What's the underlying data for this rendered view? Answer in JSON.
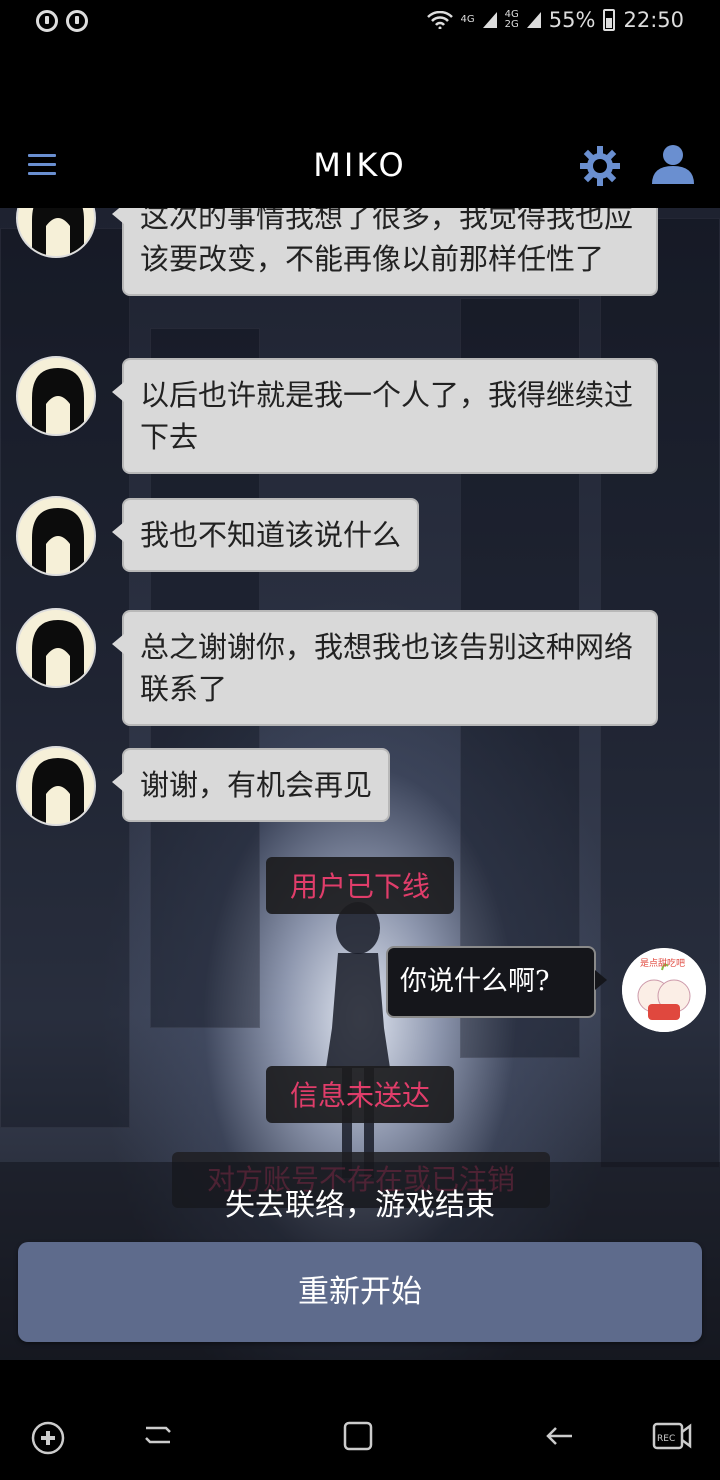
{
  "status_bar": {
    "network_1": "4G",
    "network_2a": "4G",
    "network_2b": "2G",
    "battery": "55%",
    "time": "22:50"
  },
  "app_bar": {
    "title": "MIKO",
    "icons": [
      "menu-icon",
      "gear-icon",
      "user-icon"
    ]
  },
  "messages": [
    {
      "sender": "miko",
      "text": "这次的事情我想了很多，我觉得我也应该要改变，不能再像以前那样任性了"
    },
    {
      "sender": "miko",
      "text": "以后也许就是我一个人了，我得继续过下去"
    },
    {
      "sender": "miko",
      "text": "我也不知道该说什么"
    },
    {
      "sender": "miko",
      "text": "总之谢谢你，我想我也该告别这种网络联系了"
    },
    {
      "sender": "miko",
      "text": "谢谢，有机会再见"
    }
  ],
  "system_1": "用户已下线",
  "my_message": "你说什么啊?",
  "my_avatar_label": "是点甜吃吧",
  "system_2": "信息未送达",
  "system_3": "对方账号不存在或已注销",
  "game_over": "失去联络，游戏结束",
  "restart_label": "重新开始",
  "colors": {
    "accent": "#6a8fd0",
    "system_text": "#e03d6a",
    "restart_button": "#5e6b8c"
  }
}
